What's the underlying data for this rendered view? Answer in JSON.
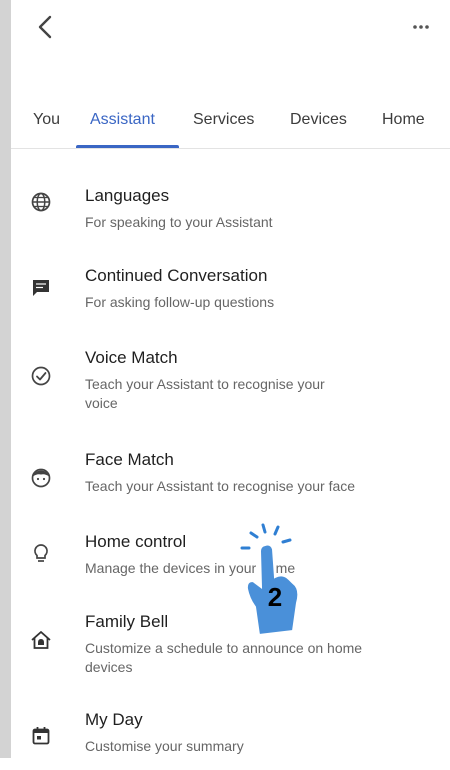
{
  "header": {
    "back_icon": "chevron-left-icon",
    "more_icon": "more-horizontal-icon"
  },
  "tabs": [
    {
      "label": "You",
      "active": false
    },
    {
      "label": "Assistant",
      "active": true
    },
    {
      "label": "Services",
      "active": false
    },
    {
      "label": "Devices",
      "active": false
    },
    {
      "label": "Home",
      "active": false
    }
  ],
  "colors": {
    "accent": "#3a66c4",
    "pointer": "#4a90d9",
    "sidebar": "#d3d3d3"
  },
  "settings": [
    {
      "icon": "globe-icon",
      "title": "Languages",
      "subtitle": "For speaking to your Assistant"
    },
    {
      "icon": "chat-icon",
      "title": "Continued Conversation",
      "subtitle": "For asking follow-up questions"
    },
    {
      "icon": "voice-match-icon",
      "title": "Voice Match",
      "subtitle": "Teach your Assistant to recognise your voice"
    },
    {
      "icon": "face-icon",
      "title": "Face Match",
      "subtitle": "Teach your Assistant to recognise your face"
    },
    {
      "icon": "lightbulb-icon",
      "title": "Home control",
      "subtitle": "Manage the devices in your home"
    },
    {
      "icon": "home-bell-icon",
      "title": "Family Bell",
      "subtitle": "Customize a schedule to announce on home devices"
    },
    {
      "icon": "calendar-icon",
      "title": "My Day",
      "subtitle": "Customise your summary"
    }
  ],
  "annotation": {
    "step_number": "2",
    "pointer_icon": "tap-hand-icon"
  }
}
